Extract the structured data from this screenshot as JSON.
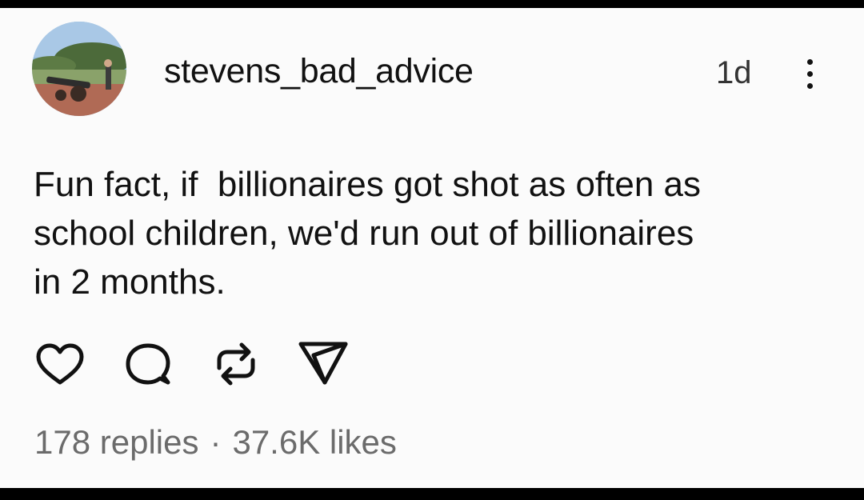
{
  "post": {
    "username": "stevens_bad_advice",
    "time_ago": "1d",
    "text": "Fun fact, if  billionaires got shot as often as\nschool children, we'd run out of billionaires\nin 2 months.",
    "replies": "178 replies",
    "separator": "·",
    "likes": "37.6K likes"
  },
  "icons": {
    "avatar": "profile-photo-cannon",
    "more": "more-vertical-icon",
    "like": "heart-icon",
    "reply": "comment-icon",
    "repost": "repost-icon",
    "share": "send-icon"
  }
}
